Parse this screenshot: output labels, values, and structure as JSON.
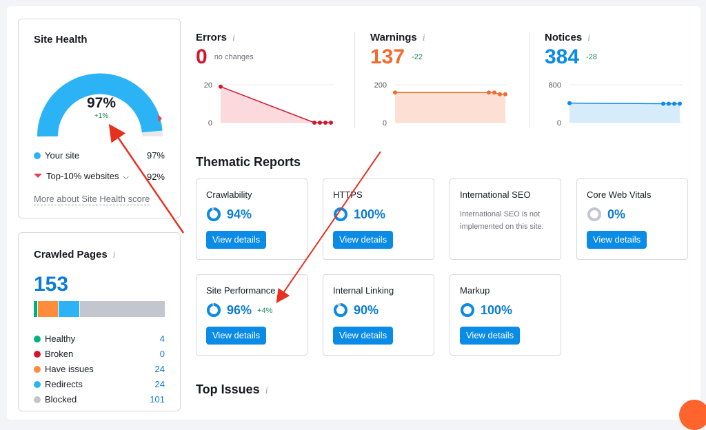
{
  "site_health": {
    "title": "Site Health",
    "score": "97%",
    "score_change": "+1%",
    "score_fraction": 0.97,
    "your_site_label": "Your site",
    "your_site_value": "97%",
    "top10_label": "Top-10% websites",
    "top10_value": "92%",
    "more_link": "More about Site Health score"
  },
  "crawled_pages": {
    "title": "Crawled Pages",
    "info": "i",
    "total": "153",
    "items": [
      {
        "label": "Healthy",
        "value": "4",
        "color": "#00b37e",
        "count": 4
      },
      {
        "label": "Broken",
        "value": "0",
        "color": "#d1182b",
        "count": 0
      },
      {
        "label": "Have issues",
        "value": "24",
        "color": "#ff8c3a",
        "count": 24
      },
      {
        "label": "Redirects",
        "value": "24",
        "color": "#2bb3f5",
        "count": 24
      },
      {
        "label": "Blocked",
        "value": "101",
        "color": "#c3c6cf",
        "count": 101
      }
    ]
  },
  "metrics": [
    {
      "label": "Errors",
      "info": "i",
      "value": "0",
      "change": "no changes",
      "color": "#d1182b",
      "change_color": "#6b707c",
      "fill": "#fcd9dc",
      "ymax_label": "20",
      "ymin_label": "0",
      "ymax": 20,
      "points": [
        19,
        0,
        0,
        0,
        0
      ]
    },
    {
      "label": "Warnings",
      "info": "i",
      "value": "137",
      "change": "-22",
      "color": "#f26b2d",
      "change_color": "#1a8a55",
      "fill": "#fddfd3",
      "ymax_label": "200",
      "ymin_label": "0",
      "ymax": 200,
      "points": [
        159,
        159,
        159,
        150,
        150
      ]
    },
    {
      "label": "Notices",
      "info": "i",
      "value": "384",
      "change": "-28",
      "color": "#0a8be6",
      "change_color": "#1a8a55",
      "fill": "#d6ecfb",
      "ymax_label": "800",
      "ymin_label": "0",
      "ymax": 800,
      "points": [
        412,
        400,
        400,
        400,
        400
      ]
    }
  ],
  "thematic": {
    "title": "Thematic Reports",
    "view_label": "View details",
    "reports": [
      {
        "name": "Crawlability",
        "value": "94%",
        "fraction": 0.94
      },
      {
        "name": "HTTPS",
        "value": "100%",
        "fraction": 1.0
      },
      {
        "name": "International SEO",
        "note": "International SEO is not implemented on this site."
      },
      {
        "name": "Core Web Vitals",
        "value": "0%",
        "fraction": 0.0
      },
      {
        "name": "Site Performance",
        "value": "96%",
        "fraction": 0.96,
        "delta": "+4%"
      },
      {
        "name": "Internal Linking",
        "value": "90%",
        "fraction": 0.9
      },
      {
        "name": "Markup",
        "value": "100%",
        "fraction": 1.0
      }
    ]
  },
  "top_issues": {
    "title": "Top Issues",
    "info": "i"
  }
}
